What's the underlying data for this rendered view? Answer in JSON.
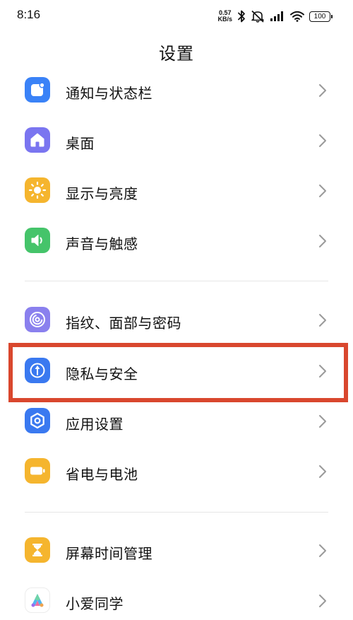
{
  "status_bar": {
    "time": "8:16",
    "net_speed_value": "0.57",
    "net_speed_unit": "KB/s",
    "battery": "100",
    "icons": [
      "bluetooth-icon",
      "mute-icon",
      "signal-icon",
      "wifi-icon",
      "battery-icon"
    ]
  },
  "header": {
    "title": "设置"
  },
  "settings": {
    "items": [
      {
        "label": "通知与状态栏",
        "icon": "notification-icon",
        "color": "#3a82f7"
      },
      {
        "label": "桌面",
        "icon": "home-icon",
        "color": "#7a75f0"
      },
      {
        "label": "显示与亮度",
        "icon": "sun-icon",
        "color": "#f5b52e"
      },
      {
        "label": "声音与触感",
        "icon": "speaker-icon",
        "color": "#45c46a"
      },
      {
        "label": "指纹、面部与密码",
        "icon": "fingerprint-icon",
        "color": "#8a80ee"
      },
      {
        "label": "隐私与安全",
        "icon": "privacy-icon",
        "color": "#3a79f0"
      },
      {
        "label": "应用设置",
        "icon": "app-settings-icon",
        "color": "#3a79f0"
      },
      {
        "label": "省电与电池",
        "icon": "battery-saver-icon",
        "color": "#f5b52e"
      },
      {
        "label": "屏幕时间管理",
        "icon": "hourglass-icon",
        "color": "#f5b52e"
      },
      {
        "label": "小爱同学",
        "icon": "xiaoai-icon",
        "color": "#ffffff"
      }
    ]
  },
  "colors": {
    "highlight": "#d9472e",
    "chevron": "#9a9a9a",
    "divider": "#e6e6e6"
  }
}
